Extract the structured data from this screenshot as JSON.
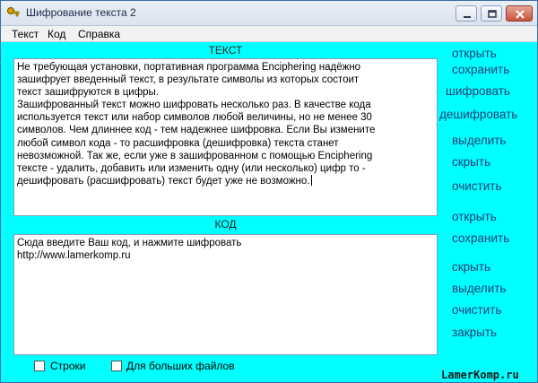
{
  "window": {
    "title": "Шифрование текста 2",
    "controls": [
      "minimize-icon",
      "maximize-icon",
      "close-icon"
    ]
  },
  "menu": {
    "items": [
      "Текст",
      "Код",
      "Справка"
    ]
  },
  "text_section": {
    "header": "ТЕКСТ",
    "content": "Не требующая установки, портативная программа Enciphering надёжно\nзашифрует введенный текст, в результате символы из которых состоит\nтекст зашифруются в цифры.\nЗашифрованный текст можно шифровать несколько раз. В качестве кода\nиспользуется текст или набор символов любой величины, но не менее 30\nсимволов. Чем длиннее код - тем надежнее шифровка. Если Вы измените\nлюбой символ кода - то расшифровка (дешифровка) текста станет\nневозможной. Так же, если уже в зашифрованном с помощью Enciphering\nтексте - удалить, добавить или изменить одну (или несколько) цифр то -\nдешифровать (расшифровать) текст будет уже не возможно."
  },
  "code_section": {
    "header": "КОД",
    "content": "Сюда введите Ваш код, и нажмите шифровать\nhttp://www.lamerkomp.ru"
  },
  "text_actions": [
    "открыть",
    "сохранить",
    "шифровать",
    "дешифровать",
    "выделить",
    "скрыть",
    "очистить"
  ],
  "code_actions": [
    "открыть",
    "сохранить",
    "скрыть",
    "выделить",
    "очистить",
    "закрыть"
  ],
  "options": {
    "lines": {
      "label": "Строки",
      "checked": false
    },
    "large_files": {
      "label": "Для больших файлов",
      "checked": false
    }
  },
  "watermark": "LamerKomp.ru",
  "colors": {
    "window_background": "#00ffff",
    "action_text": "#1e3f7a"
  }
}
